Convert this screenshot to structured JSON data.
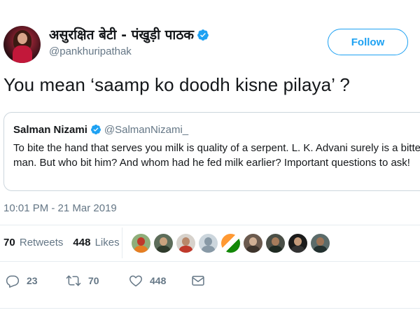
{
  "tweet": {
    "author": {
      "display_name": "असुरक्षित बेटी - पंखुड़ी पाठक",
      "handle": "@pankhuripathak",
      "verified": true
    },
    "follow_label": "Follow",
    "text": "You mean ‘saamp ko doodh kisne pilaya’ ?",
    "quoted": {
      "author_name": "Salman Nizami",
      "author_handle": "@SalmanNizami_",
      "verified": true,
      "text": "To bite the hand that serves you milk is quality of a serpent. L. K. Advani surely is a bitten man. But who bit him? And whom had he fed milk earlier? Important questions to ask!"
    },
    "timestamp": "10:01 PM - 21 Mar 2019",
    "stats": {
      "retweets_count": "70",
      "retweets_label": "Retweets",
      "likes_count": "448",
      "likes_label": "Likes"
    },
    "liker_avatars": [
      "avatar-1",
      "avatar-2",
      "avatar-3",
      "avatar-4",
      "avatar-5",
      "avatar-6",
      "avatar-7",
      "avatar-8",
      "avatar-9"
    ],
    "actions": {
      "reply_count": "23",
      "retweet_count": "70",
      "like_count": "448"
    }
  },
  "colors": {
    "accent": "#1da1f2",
    "text_primary": "#14171a",
    "text_secondary": "#657786",
    "border": "#ccd6dd",
    "divider": "#e6ecf0"
  },
  "icons": {
    "verified": "verified-badge-icon",
    "reply": "reply-icon",
    "retweet": "retweet-icon",
    "like": "heart-icon",
    "message": "direct-message-icon"
  }
}
